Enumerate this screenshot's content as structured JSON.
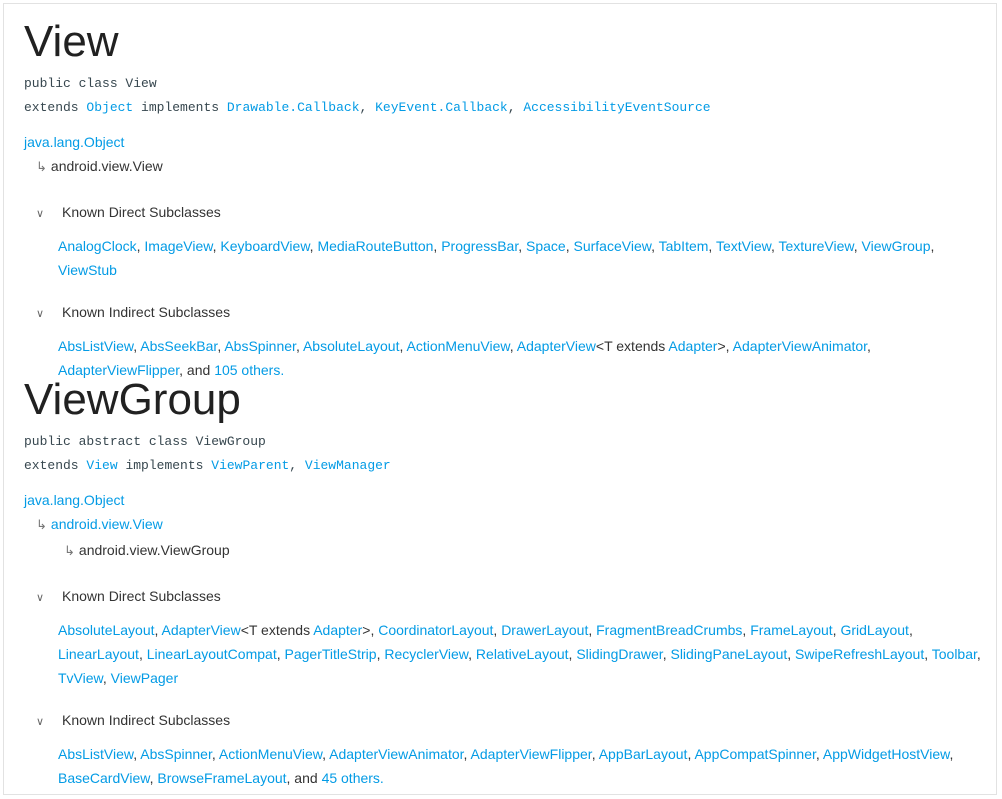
{
  "sections": [
    {
      "title": "View",
      "decl": "public class View",
      "extends_kw": "extends",
      "extends_link": "Object",
      "implements_kw": "implements",
      "implements": [
        "Drawable.Callback",
        "KeyEvent.Callback",
        "AccessibilityEventSource"
      ],
      "hierarchy": [
        {
          "text": "java.lang.Object",
          "link": true
        },
        {
          "text": "android.view.View",
          "link": false
        }
      ],
      "direct_label": "Known Direct Subclasses",
      "direct": [
        "AnalogClock",
        "ImageView",
        "KeyboardView",
        "MediaRouteButton",
        "ProgressBar",
        "Space",
        "SurfaceView",
        "TabItem",
        "TextView",
        "TextureView",
        "ViewGroup",
        "ViewStub"
      ],
      "indirect_label": "Known Indirect Subclasses",
      "indirect": [
        "AbsListView",
        "AbsSeekBar",
        "AbsSpinner",
        "AbsoluteLayout",
        "ActionMenuView",
        "AdapterView<T extends Adapter>",
        "AdapterViewAnimator",
        "AdapterViewFlipper"
      ],
      "others_prefix": "and",
      "others_link": "105 others."
    },
    {
      "title": "ViewGroup",
      "decl": "public abstract class ViewGroup",
      "extends_kw": "extends",
      "extends_link": "View",
      "implements_kw": "implements",
      "implements": [
        "ViewParent",
        "ViewManager"
      ],
      "hierarchy": [
        {
          "text": "java.lang.Object",
          "link": true
        },
        {
          "text": "android.view.View",
          "link": true
        },
        {
          "text": "android.view.ViewGroup",
          "link": false
        }
      ],
      "direct_label": "Known Direct Subclasses",
      "direct": [
        "AbsoluteLayout",
        "AdapterView<T extends Adapter>",
        "CoordinatorLayout",
        "DrawerLayout",
        "FragmentBreadCrumbs",
        "FrameLayout",
        "GridLayout",
        "LinearLayout",
        "LinearLayoutCompat",
        "PagerTitleStrip",
        "RecyclerView",
        "RelativeLayout",
        "SlidingDrawer",
        "SlidingPaneLayout",
        "SwipeRefreshLayout",
        "Toolbar",
        "TvView",
        "ViewPager"
      ],
      "indirect_label": "Known Indirect Subclasses",
      "indirect": [
        "AbsListView",
        "AbsSpinner",
        "ActionMenuView",
        "AdapterViewAnimator",
        "AdapterViewFlipper",
        "AppBarLayout",
        "AppCompatSpinner",
        "AppWidgetHostView",
        "BaseCardView",
        "BrowseFrameLayout"
      ],
      "others_prefix": "and",
      "others_link": "45 others."
    }
  ],
  "colors": {
    "link": "#039be5",
    "text": "#333333",
    "title": "#212121"
  },
  "icons": {
    "collapse": "chevron-down-icon",
    "hierarchy": "subdirectory-arrow-icon"
  }
}
